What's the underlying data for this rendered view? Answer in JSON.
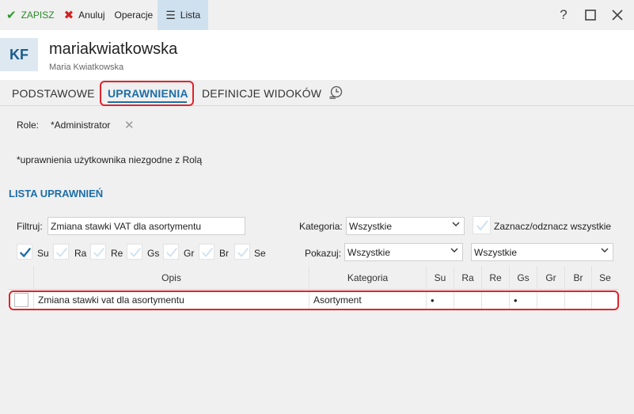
{
  "toolbar": {
    "save_label": "ZAPISZ",
    "cancel_label": "Anuluj",
    "operations_label": "Operacje",
    "list_label": "Lista",
    "help_icon": "?"
  },
  "header": {
    "initials": "KF",
    "login": "mariakwiatkowska",
    "full_name": "Maria Kwiatkowska"
  },
  "tabs": [
    {
      "label": "PODSTAWOWE"
    },
    {
      "label": "UPRAWNIENIA"
    },
    {
      "label": "DEFINICJE WIDOKÓW"
    }
  ],
  "role": {
    "label": "Role:",
    "value": "*Administrator"
  },
  "note": "*uprawnienia użytkownika niezgodne z Rolą",
  "section_title": "LISTA UPRAWNIEŃ",
  "filters": {
    "filter_label": "Filtruj:",
    "filter_value": "Zmiana stawki VAT dla asortymentu",
    "category_label": "Kategoria:",
    "category_value": "Wszystkie",
    "toggle_all_label": "Zaznacz/odznacz wszystkie",
    "show_label": "Pokazuj:",
    "show_value": "Wszystkie",
    "show_value_2": "Wszystkie"
  },
  "perm_checks": [
    {
      "label": "Su",
      "checked": true
    },
    {
      "label": "Ra",
      "checked": false
    },
    {
      "label": "Re",
      "checked": false
    },
    {
      "label": "Gs",
      "checked": false
    },
    {
      "label": "Gr",
      "checked": false
    },
    {
      "label": "Br",
      "checked": false
    },
    {
      "label": "Se",
      "checked": false
    }
  ],
  "table": {
    "columns": [
      "Opis",
      "Kategoria",
      "Su",
      "Ra",
      "Re",
      "Gs",
      "Gr",
      "Br",
      "Se"
    ],
    "rows": [
      {
        "opis": "Zmiana stawki vat dla asortymentu",
        "kategoria": "Asortyment",
        "su": "•",
        "ra": "",
        "re": "",
        "gs": "•",
        "gr": "",
        "br": "",
        "se": ""
      }
    ]
  },
  "colors": {
    "accent": "#1d6ea8",
    "highlight": "#e0242c",
    "save_green": "#2a9a2a",
    "cancel_red": "#d42020"
  }
}
